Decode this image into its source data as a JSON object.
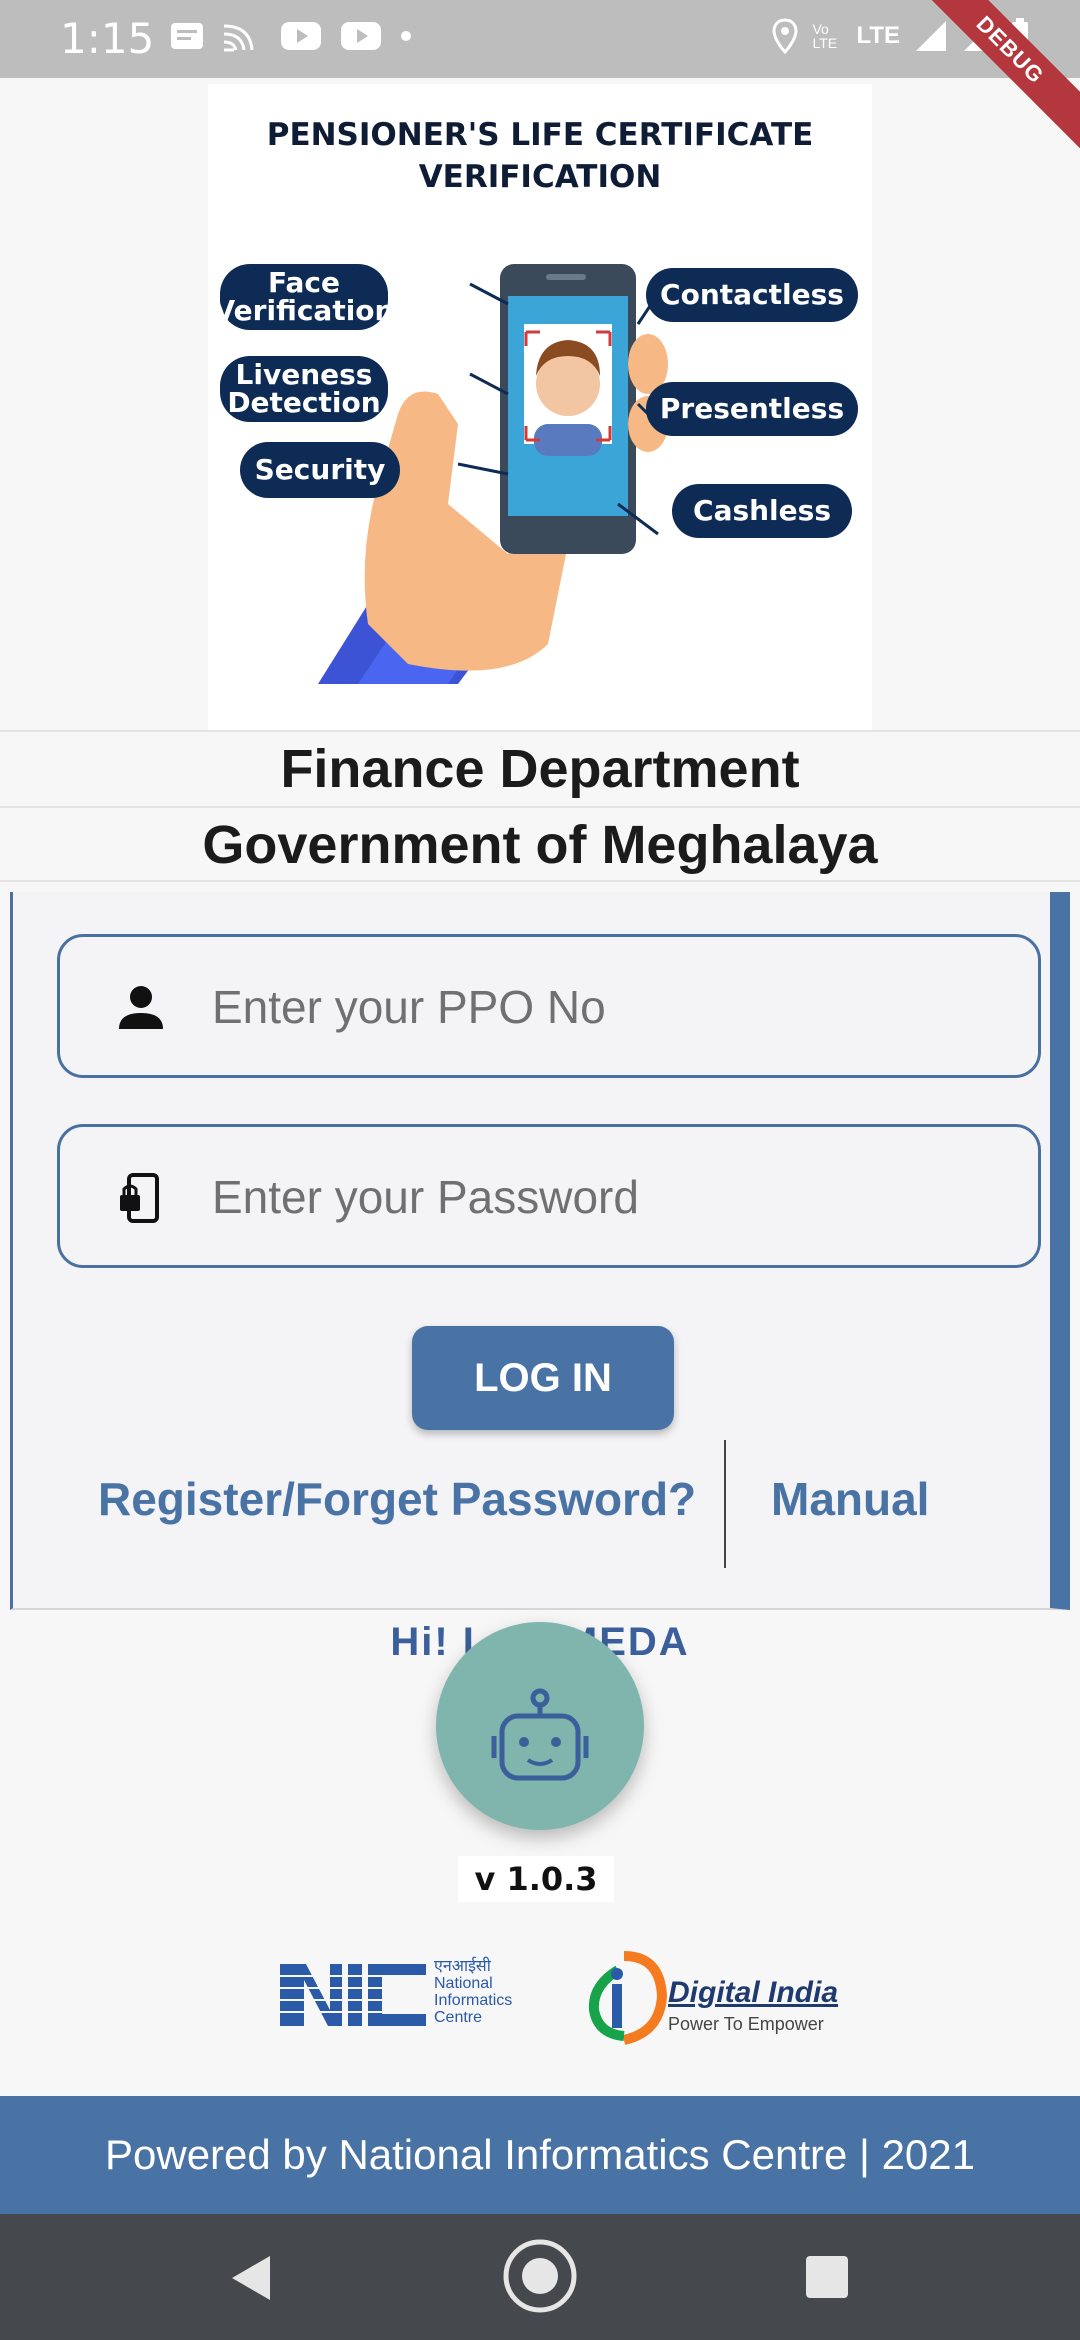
{
  "status_bar": {
    "time": "1:15",
    "icons_left": [
      "message-icon",
      "cast-icon",
      "youtube-icon",
      "youtube-icon",
      "dot-icon"
    ],
    "icons_right": [
      "location-icon",
      "volte-icon",
      "lte-icon",
      "signal-icon",
      "signal-icon",
      "battery-icon"
    ],
    "volte_label": "Vo LTE",
    "lte_label": "LTE",
    "debug_label": "DEBUG"
  },
  "banner": {
    "title_line1": "PENSIONER'S LIFE CERTIFICATE",
    "title_line2": "VERIFICATION",
    "features": {
      "face_verification": "Face Verification",
      "liveness_detection": "Liveness Detection",
      "security": "Security",
      "contactless": "Contactless",
      "presentless": "Presentless",
      "cashless": "Cashless"
    }
  },
  "org": {
    "line1": "Finance Department",
    "line2": "Government of Meghalaya"
  },
  "login": {
    "ppo_placeholder": "Enter your PPO No",
    "password_placeholder": "Enter your Password",
    "login_label": "LOG IN",
    "register_link": "Register/Forget Password?",
    "manual_link": "Manual"
  },
  "assistant": {
    "greeting": "Hi! I am MEDA",
    "version": "v 1.0.3"
  },
  "logos": {
    "nic_hindi": "एनआईसी",
    "nic_line1": "National",
    "nic_line2": "Informatics",
    "nic_line3": "Centre",
    "di_title": "Digital India",
    "di_tagline": "Power To Empower"
  },
  "footer": {
    "text": "Powered by National Informatics Centre | 2021"
  },
  "colors": {
    "primary": "#4a73a5",
    "navy": "#0e2b55",
    "fab": "#7fb5ad"
  }
}
